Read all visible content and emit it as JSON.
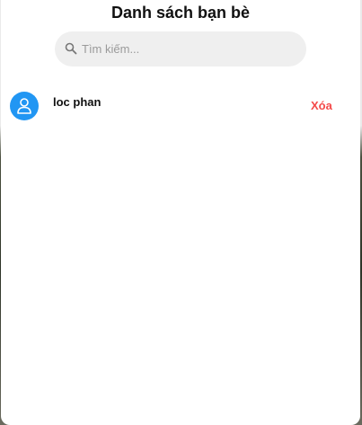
{
  "dialog": {
    "title": "Danh sách bạn bè"
  },
  "search": {
    "placeholder": "Tìm kiếm...",
    "value": "",
    "icon": "search-icon"
  },
  "friends": [
    {
      "name": "loc phan",
      "avatar_icon": "user-icon",
      "avatar_color": "#2196f3",
      "delete_label": "Xóa",
      "delete_color": "#f44a4a"
    }
  ]
}
